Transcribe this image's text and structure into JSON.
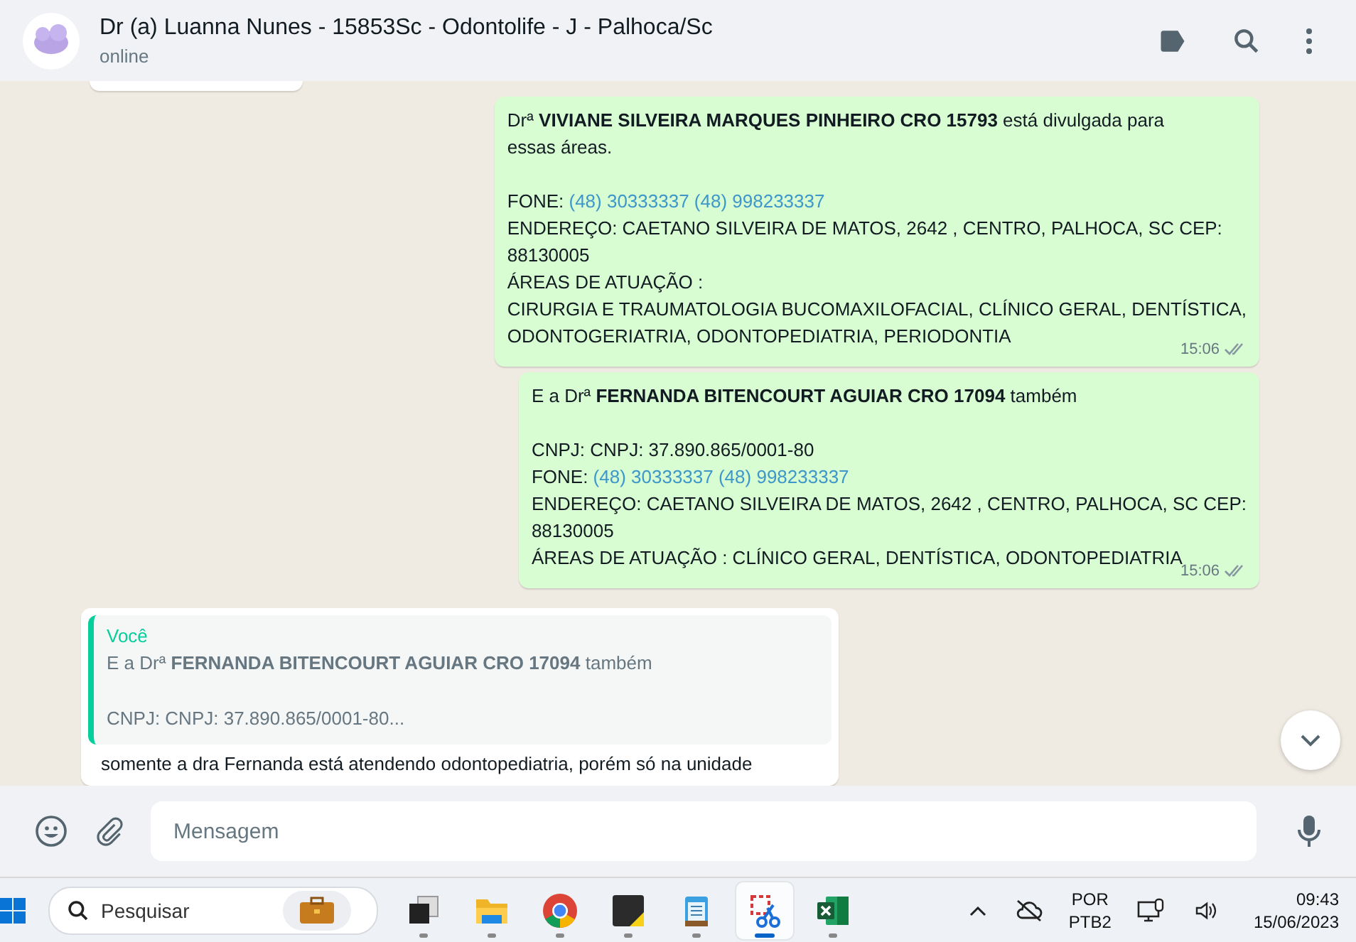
{
  "header": {
    "title": "Dr (a) Luanna Nunes - 15853Sc - Odontolife - J - Palhoca/Sc",
    "status": "online"
  },
  "messages": [
    {
      "kind": "outgoing",
      "time": "15:06",
      "blocks": [
        [
          {
            "text": "Drª **VIVIANE SILVEIRA MARQUES PINHEIRO CRO 15793** está divulgada para"
          },
          {
            "text": "essas áreas."
          }
        ],
        [
          {
            "text": "FONE:",
            "link": "(48) 30333337 (48) 998233337"
          },
          {
            "text": "ENDEREÇO: CAETANO SILVEIRA DE MATOS, 2642 , CENTRO, PALHOCA, SC CEP:"
          },
          {
            "text": "88130005"
          },
          {
            "text": "ÁREAS DE ATUAÇÃO :"
          },
          {
            "text": "CIRURGIA E TRAUMATOLOGIA BUCOMAXILOFACIAL, CLÍNICO GERAL, DENTÍSTICA,"
          },
          {
            "text": "ODONTOGERIATRIA, ODONTOPEDIATRIA, PERIODONTIA"
          }
        ]
      ]
    },
    {
      "kind": "outgoing",
      "time": "15:06",
      "blocks": [
        [
          {
            "text": "E a Drª **FERNANDA BITENCOURT AGUIAR CRO 17094** também"
          }
        ],
        [
          {
            "text": "CNPJ: CNPJ: 37.890.865/0001-80"
          },
          {
            "text": "FONE:",
            "link": "(48) 30333337 (48) 998233337"
          },
          {
            "text": "ENDEREÇO: CAETANO SILVEIRA DE MATOS, 2642 , CENTRO, PALHOCA, SC CEP:"
          },
          {
            "text": "88130005"
          },
          {
            "text": "ÁREAS DE ATUAÇÃO : CLÍNICO GERAL, DENTÍSTICA, ODONTOPEDIATRIA"
          }
        ]
      ]
    },
    {
      "kind": "incoming",
      "quote": {
        "author": "Você",
        "lines": [
          "E a Drª **FERNANDA BITENCOURT AGUIAR CRO 17094** também",
          "CNPJ: CNPJ: 37.890.865/0001-80..."
        ]
      },
      "blocks": [
        [
          {
            "text": "somente a dra Fernanda está atendendo odontopediatria, porém só na unidade"
          }
        ]
      ]
    }
  ],
  "composer": {
    "placeholder": "Mensagem"
  },
  "taskbar": {
    "search_placeholder": "Pesquisar",
    "apps": [
      {
        "kind": "taskview",
        "selected": false
      },
      {
        "kind": "folder",
        "selected": false
      },
      {
        "kind": "browser",
        "selected": false
      },
      {
        "kind": "note",
        "selected": false
      },
      {
        "kind": "notepad",
        "selected": false
      },
      {
        "kind": "snip",
        "selected": true
      },
      {
        "kind": "sheet",
        "selected": false
      }
    ],
    "language": [
      "POR",
      "PTB2"
    ],
    "time": "09:43",
    "date": "15/06/2023"
  }
}
